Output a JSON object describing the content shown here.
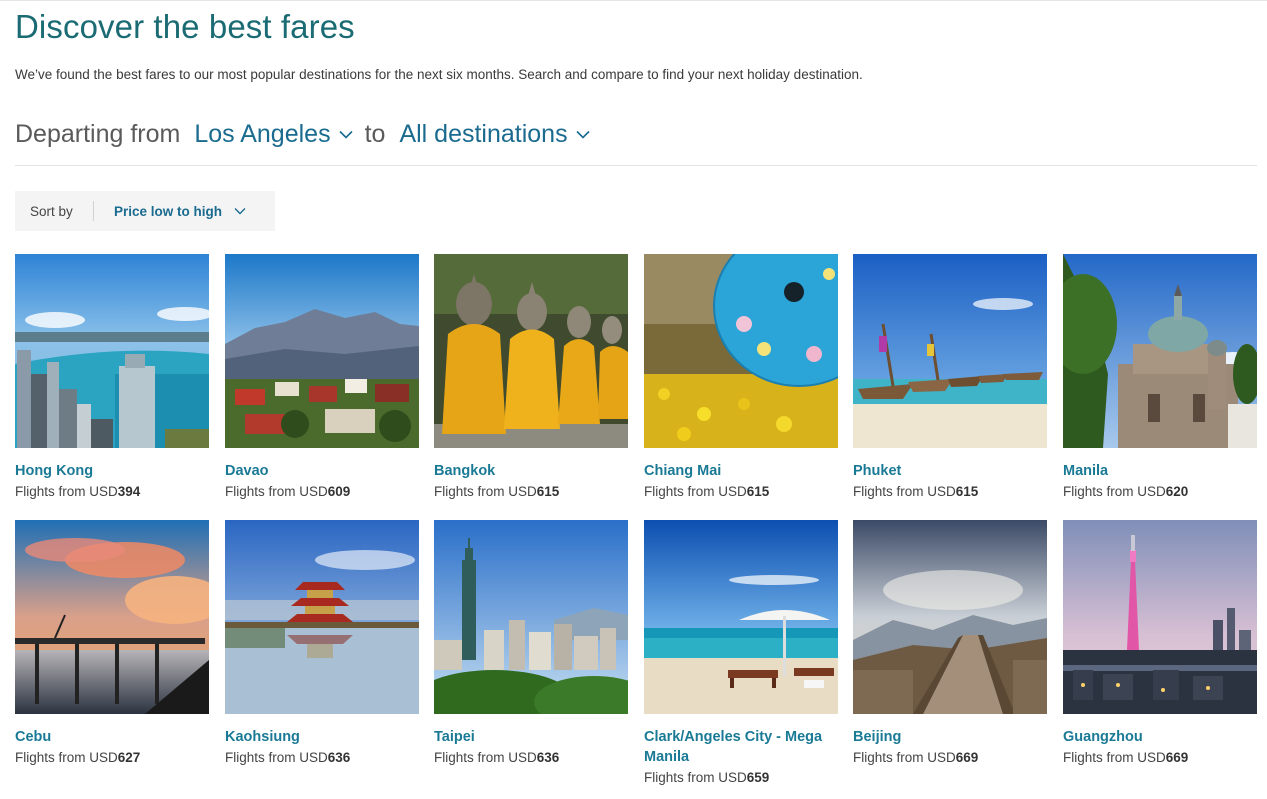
{
  "page": {
    "title": "Discover the best fares",
    "subtitle": "We’ve found the best fares to our most popular destinations for the next six months. Search and compare to find your next holiday destination."
  },
  "search": {
    "departing_label": "Departing from",
    "origin": "Los Angeles",
    "to_label": "to",
    "destination": "All destinations"
  },
  "sort": {
    "label": "Sort by",
    "value": "Price low to high"
  },
  "colors": {
    "accent": "#1a6b73",
    "link": "#1a7a96"
  },
  "destinations": [
    {
      "city": "Hong Kong",
      "price_prefix": "Flights from USD",
      "price": "394",
      "image": "hong-kong-skyline-harbor-image"
    },
    {
      "city": "Davao",
      "price_prefix": "Flights from USD",
      "price": "609",
      "image": "davao-mountain-village-image"
    },
    {
      "city": "Bangkok",
      "price_prefix": "Flights from USD",
      "price": "615",
      "image": "bangkok-buddha-statues-image"
    },
    {
      "city": "Chiang Mai",
      "price_prefix": "Flights from USD",
      "price": "615",
      "image": "chiang-mai-umbrella-image"
    },
    {
      "city": "Phuket",
      "price_prefix": "Flights from USD",
      "price": "615",
      "image": "phuket-longtail-boats-image"
    },
    {
      "city": "Manila",
      "price_prefix": "Flights from USD",
      "price": "620",
      "image": "manila-cathedral-image"
    },
    {
      "city": "Cebu",
      "price_prefix": "Flights from USD",
      "price": "627",
      "image": "cebu-pier-sunset-image"
    },
    {
      "city": "Kaohsiung",
      "price_prefix": "Flights from USD",
      "price": "636",
      "image": "kaohsiung-pagoda-lake-image"
    },
    {
      "city": "Taipei",
      "price_prefix": "Flights from USD",
      "price": "636",
      "image": "taipei-101-skyline-image"
    },
    {
      "city": "Clark/Angeles City - Mega Manila",
      "price_prefix": "Flights from USD",
      "price": "659",
      "image": "clark-beach-umbrella-image"
    },
    {
      "city": "Beijing",
      "price_prefix": "Flights from USD",
      "price": "669",
      "image": "beijing-great-wall-image"
    },
    {
      "city": "Guangzhou",
      "price_prefix": "Flights from USD",
      "price": "669",
      "image": "guangzhou-canton-tower-image"
    }
  ]
}
